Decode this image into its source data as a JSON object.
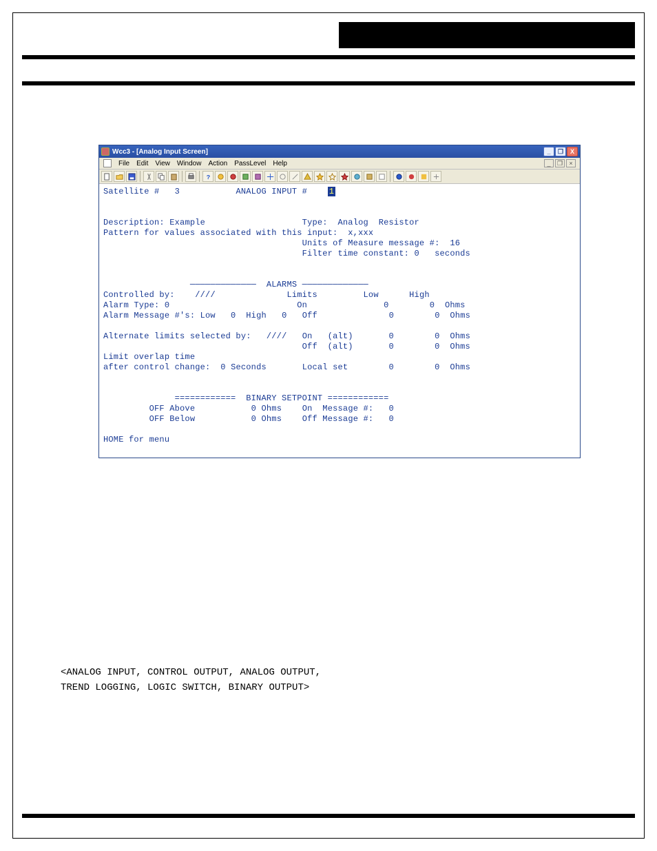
{
  "window": {
    "title": "Wcc3 - [Analog Input Screen]",
    "buttons": {
      "min": "_",
      "max": "❐",
      "close": "X"
    },
    "menu": [
      "File",
      "Edit",
      "View",
      "Window",
      "Action",
      "PassLevel",
      "Help"
    ],
    "mdi": {
      "min": "_",
      "max": "❐",
      "close": "×"
    }
  },
  "header": {
    "satellite_label": "Satellite #",
    "satellite_num": "3",
    "analog_input_label": "ANALOG INPUT #",
    "analog_input_num": "1"
  },
  "info": {
    "description_label": "Description:",
    "description_value": "Example",
    "type_label": "Type:",
    "type_value": "Analog  Resistor",
    "pattern_label": "Pattern for values associated with this input:",
    "pattern_value": "x,xxx",
    "units_label": "Units of Measure message #:",
    "units_value": "16",
    "filter_label": "Filter time constant:",
    "filter_value": "0",
    "filter_units": "seconds"
  },
  "alarms": {
    "title": "ALARMS",
    "controlled_by_label": "Controlled by:",
    "controlled_by_value": "////",
    "limits_label": "Limits",
    "low_header": "Low",
    "high_header": "High",
    "alarm_type_label": "Alarm Type:",
    "alarm_type_value": "0",
    "alarm_msg_label": "Alarm Message #'s: Low",
    "alarm_msg_low": "0",
    "alarm_msg_high_label": "High",
    "alarm_msg_high": "0",
    "on_label": "On",
    "off_label": "Off",
    "on_low": "0",
    "on_high": "0",
    "on_units": "Ohms",
    "off_low": "0",
    "off_high": "0",
    "off_units": "Ohms",
    "alt_selected_label": "Alternate limits selected by:",
    "alt_selected_value": "////",
    "on_alt_label": "On   (alt)",
    "off_alt_label": "Off  (alt)",
    "on_alt_low": "0",
    "on_alt_high": "0",
    "on_alt_units": "Ohms",
    "off_alt_low": "0",
    "off_alt_high": "0",
    "off_alt_units": "Ohms",
    "overlap_label": "Limit overlap time",
    "after_change_label": "after control change:",
    "after_change_value": "0",
    "after_change_units": "Seconds",
    "local_set_label": "Local set",
    "local_low": "0",
    "local_high": "0",
    "local_units": "Ohms"
  },
  "binset": {
    "title": "BINARY SETPOINT",
    "off_above_label": "OFF Above",
    "off_above_value": "0",
    "off_above_units": "Ohms",
    "on_msg_label": "On  Message #:",
    "on_msg_value": "0",
    "off_below_label": "OFF Below",
    "off_below_value": "0",
    "off_below_units": "Ohms",
    "off_msg_label": "Off Message #:",
    "off_msg_value": "0"
  },
  "footer": "HOME for menu",
  "body_text": {
    "line1": "<ANALOG INPUT, CONTROL OUTPUT, ANALOG OUTPUT,",
    "line2": " TREND LOGGING, LOGIC SWITCH, BINARY OUTPUT>"
  }
}
